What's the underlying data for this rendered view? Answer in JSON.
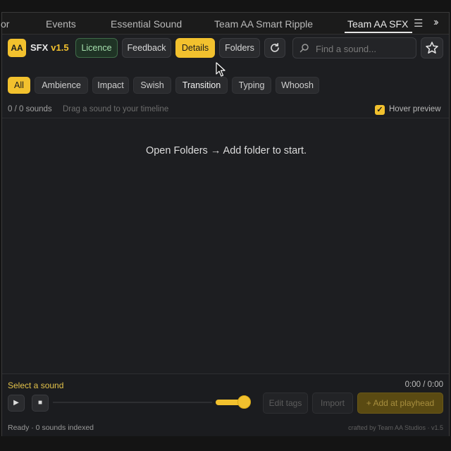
{
  "tabs": [
    {
      "label": "or"
    },
    {
      "label": "Events"
    },
    {
      "label": "Essential Sound"
    },
    {
      "label": "Team AA Smart Ripple"
    },
    {
      "label": "Team AA SFX"
    }
  ],
  "tab_menu_icon": "hamburger-icon",
  "overflow_icon": "chevron-double-right-icon",
  "toolbar": {
    "logo_text": "AA",
    "brand_name": "SFX",
    "version": "v1.5",
    "licence_label": "Licence",
    "feedback_label": "Feedback",
    "details_label": "Details",
    "folders_label": "Folders",
    "refresh_icon": "refresh-icon",
    "search_placeholder": "Find a sound...",
    "search_value": "",
    "star_icon": "star-icon"
  },
  "categories": [
    "All",
    "Ambience",
    "Impact",
    "Swish",
    "Transition",
    "Typing",
    "Whoosh"
  ],
  "active_category": "All",
  "status": {
    "count": "0 / 0 sounds",
    "hint": "Drag a sound to your timeline",
    "hover_preview_label": "Hover preview",
    "hover_preview_checked": true
  },
  "empty_message": "Open Folders → Add folder to start.",
  "player": {
    "select_label": "Select a sound",
    "time": "0:00 / 0:00",
    "play_icon": "play-icon",
    "stop_icon": "stop-icon",
    "volume_level": 0.9,
    "edit_tags_label": "Edit tags",
    "import_label": "Import",
    "add_label": "+ Add at playhead"
  },
  "footer": {
    "status": "Ready · 0 sounds indexed",
    "credit": "crafted by Team AA Studios · v1.5"
  },
  "colors": {
    "accent": "#f2c12e",
    "licence": "#a6e0ae",
    "background": "#1d1e21"
  }
}
